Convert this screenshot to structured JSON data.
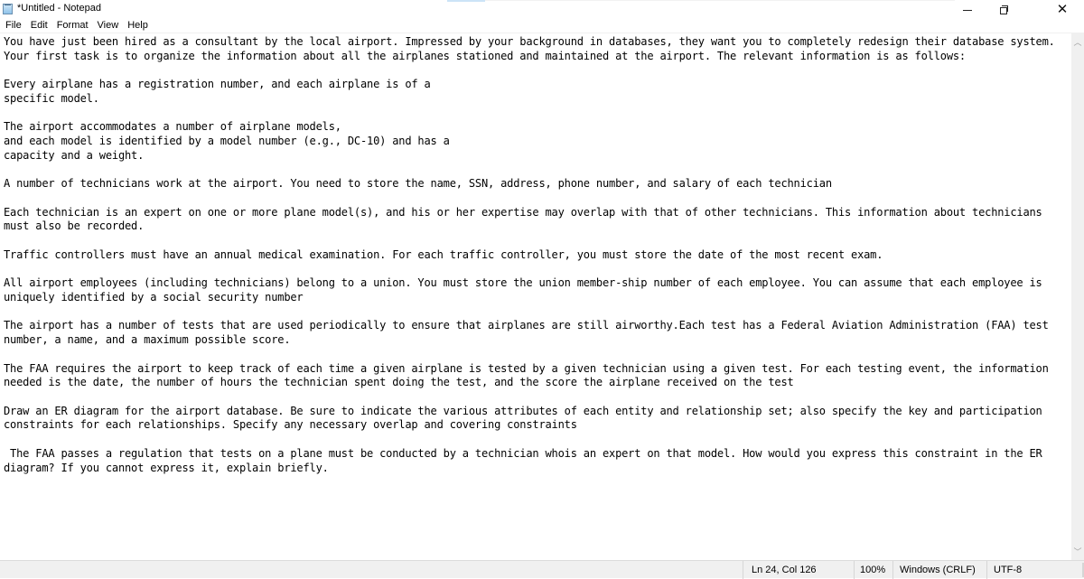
{
  "window": {
    "title": "*Untitled - Notepad",
    "app_icon": "notepad-icon",
    "controls": {
      "minimize": "minimize-icon",
      "maximize": "restore-icon",
      "close": "close-icon",
      "close_glyph": "✕"
    }
  },
  "menu": {
    "items": [
      {
        "label": "File"
      },
      {
        "label": "Edit"
      },
      {
        "label": "Format"
      },
      {
        "label": "View"
      },
      {
        "label": "Help"
      }
    ]
  },
  "editor": {
    "content": "You have just been hired as a consultant by the local airport. Impressed by your background in databases, they want you to completely redesign their database system.\nYour first task is to organize the information about all the airplanes stationed and maintained at the airport. The relevant information is as follows:\n\nEvery airplane has a registration number, and each airplane is of a\nspecific model.\n\nThe airport accommodates a number of airplane models,\nand each model is identified by a model number (e.g., DC-10) and has a\ncapacity and a weight.\n\nA number of technicians work at the airport. You need to store the name, SSN, address, phone number, and salary of each technician\n\nEach technician is an expert on one or more plane model(s), and his or her expertise may overlap with that of other technicians. This information about technicians\nmust also be recorded.\n\nTraffic controllers must have an annual medical examination. For each traffic controller, you must store the date of the most recent exam.\n\nAll airport employees (including technicians) belong to a union. You must store the union member-ship number of each employee. You can assume that each employee is\nuniquely identified by a social security number\n\nThe airport has a number of tests that are used periodically to ensure that airplanes are still airworthy.Each test has a Federal Aviation Administration (FAA) test\nnumber, a name, and a maximum possible score.\n\nThe FAA requires the airport to keep track of each time a given airplane is tested by a given technician using a given test. For each testing event, the information\nneeded is the date, the number of hours the technician spent doing the test, and the score the airplane received on the test\n\nDraw an ER diagram for the airport database. Be sure to indicate the various attributes of each entity and relationship set; also specify the key and participation\nconstraints for each relationships. Specify any necessary overlap and covering constraints\n\n The FAA passes a regulation that tests on a plane must be conducted by a technician whois an expert on that model. How would you express this constraint in the ER\ndiagram? If you cannot express it, explain briefly."
  },
  "scrollbar": {
    "up_glyph": "︿",
    "down_glyph": "﹀"
  },
  "status": {
    "position": "Ln 24, Col 126",
    "zoom": "100%",
    "line_ending": "Windows (CRLF)",
    "encoding": "UTF-8"
  }
}
